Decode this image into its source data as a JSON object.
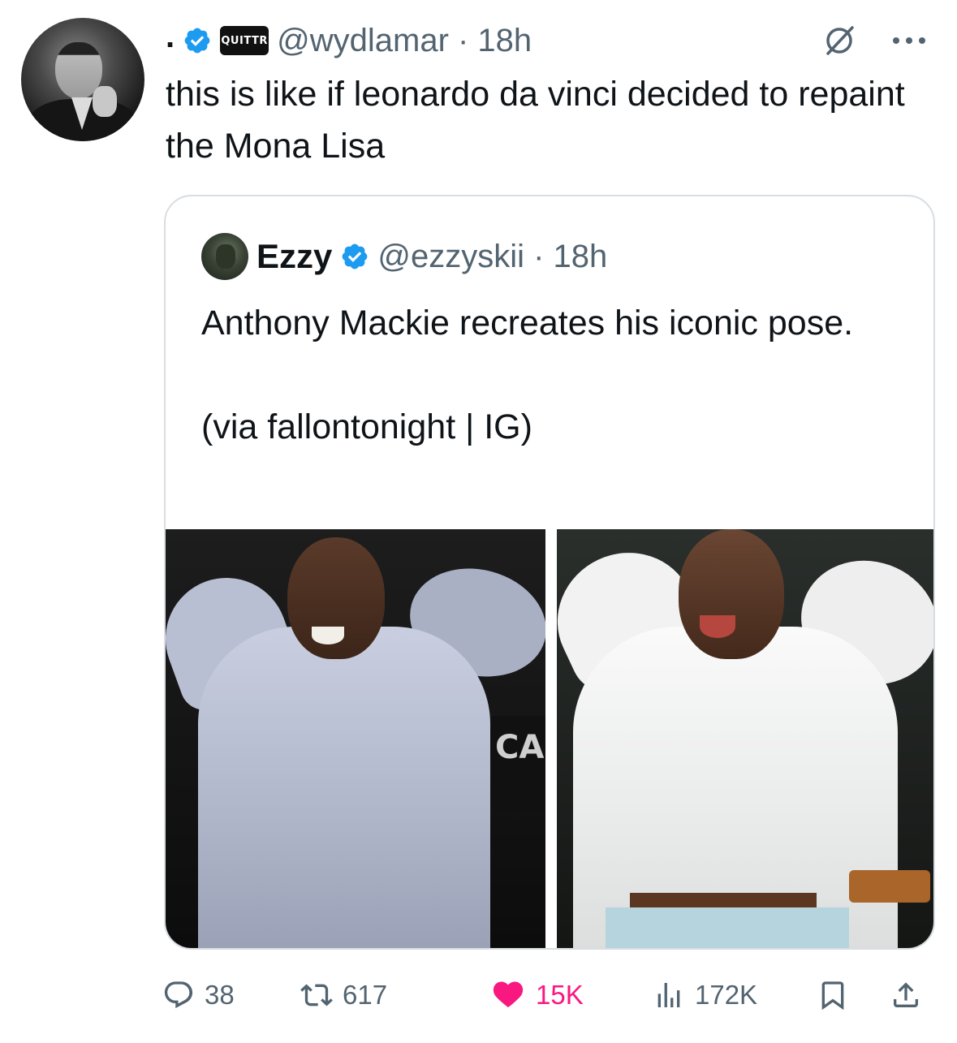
{
  "tweet": {
    "name": ".",
    "badge": "QUITTR",
    "handle_time": "@wydlamar · 18h",
    "text": "this is like if leonardo da vinci decided to repaint the Mona Lisa"
  },
  "quoted": {
    "name": "Ezzy",
    "handle_time": "@ezzyskii · 18h",
    "text": "Anthony Mackie recreates his iconic pose.\n\n(via fallontonight | IG)",
    "sign_text": "CA"
  },
  "actions": {
    "replies": "38",
    "retweets": "617",
    "likes": "15K",
    "views": "172K"
  },
  "colors": {
    "verified": "#1d9bf0",
    "like": "#f91880",
    "muted": "#536471"
  }
}
